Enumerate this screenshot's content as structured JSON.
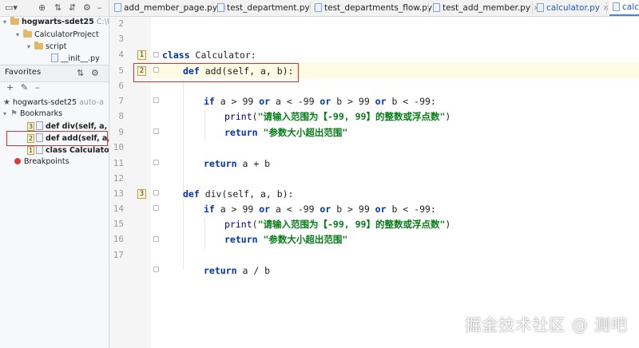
{
  "tree": {
    "root_label": "hogwarts-sdet25",
    "root_path": "C:\\Us",
    "project": "CalculatorProject",
    "script_folder": "script",
    "init_file": "__init__.py"
  },
  "favorites": {
    "title": "Favorites",
    "root_label": "hogwarts-sdet25",
    "root_suffix": "auto-a",
    "bookmarks_label": "Bookmarks",
    "bookmarks": [
      {
        "num": "3",
        "label": "def div(self, a, b):"
      },
      {
        "num": "2",
        "label": "def add(self, a, b"
      },
      {
        "num": "1",
        "label": "class Calculator: c"
      }
    ],
    "breakpoints_label": "Breakpoints"
  },
  "tabs": [
    {
      "label": "add_member_page.py"
    },
    {
      "label": "test_department.py"
    },
    {
      "label": "test_departments_flow.py"
    },
    {
      "label": "test_add_member.py"
    },
    {
      "label": "calculator.py"
    },
    {
      "label": "calc."
    }
  ],
  "editor": {
    "line_numbers": [
      "2",
      "3",
      "4",
      "5",
      "6",
      "7",
      "8",
      "9",
      "10",
      "11",
      "12",
      "13",
      "14",
      "15",
      "16",
      "17"
    ],
    "badges": [
      "1",
      "2",
      "3"
    ],
    "code": {
      "l3_kw": "class",
      "l3_name": " Calculator:",
      "l4_kw": "def",
      "l4_name": " add(self, a, b):",
      "l6_a": "if",
      "l6_b": " a > 99 ",
      "l6_c": "or",
      "l6_d": " a < -99 ",
      "l6_e": "or",
      "l6_f": " b > 99 ",
      "l6_g": "or",
      "l6_h": " b < -99:",
      "l7_fn": "print",
      "l7_p1": "(",
      "l7_str": "\"请输入范围为【-99, 99】的整数或浮点数\"",
      "l7_p2": ")",
      "l8_kw": "return",
      "l8_str": " \"参数大小超出范围\"",
      "l10_kw": "return",
      "l10_rest": " a + b",
      "l12_kw": "def",
      "l12_name": " div(self, a, b):",
      "l13_a": "if",
      "l13_b": " a > 99 ",
      "l13_c": "or",
      "l13_d": " a < -99 ",
      "l13_e": "or",
      "l13_f": " b > 99 ",
      "l13_g": "or",
      "l13_h": " b < -99:",
      "l14_fn": "print",
      "l14_p1": "(",
      "l14_str": "\"请输入范围为【-99, 99】的整数或浮点数\"",
      "l14_p2": ")",
      "l15_kw": "return",
      "l15_str": " \"参数大小超出范围\"",
      "l17_kw": "return",
      "l17_rest": " a / b"
    }
  },
  "watermark": "掘金技术社区 @ 测吧"
}
